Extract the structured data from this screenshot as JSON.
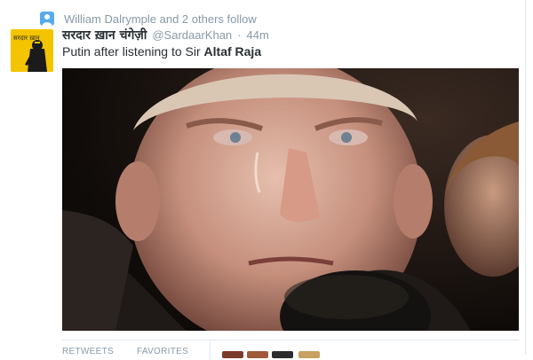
{
  "social_context": {
    "icon": "follow-icon",
    "text": "William Dalrymple and 2 others follow"
  },
  "author": {
    "fullname": "सरदार ख़ान चंगेज़ी",
    "username": "@SardaarKhan",
    "separator": "·",
    "time": "44m",
    "avatar_caption": "सरदार ख़ान"
  },
  "tweet": {
    "text_prefix": "Putin after listening to Sir ",
    "text_bold": "Altaf Raja"
  },
  "stats": {
    "retweets_label": "RETWEETS",
    "favorites_label": "FAVORITES"
  },
  "colors": {
    "accent": "#55acee",
    "muted": "#8899a6",
    "text": "#292f33",
    "avatar_bg": "#f5c400"
  }
}
